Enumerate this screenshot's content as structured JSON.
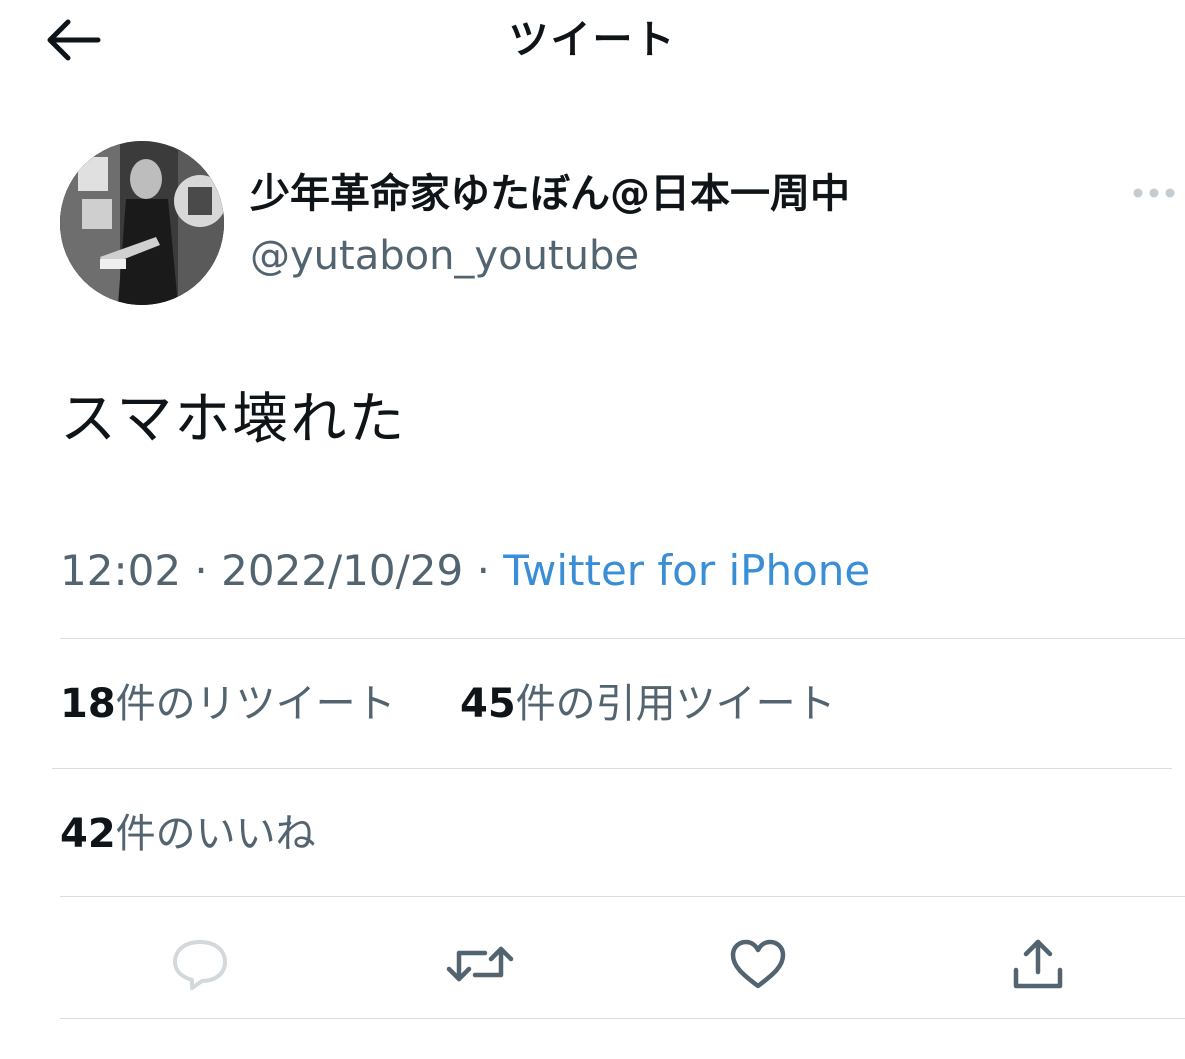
{
  "header": {
    "title": "ツイート",
    "back_icon": "arrow-left-icon"
  },
  "author": {
    "display_name": "少年革命家ゆたぼん@日本一周中",
    "handle": "@yutabon_youtube",
    "avatar_icon": "profile-photo"
  },
  "menu": {
    "more_icon": "more-horizontal-icon"
  },
  "tweet": {
    "text": "スマホ壊れた"
  },
  "meta": {
    "time": "12:02",
    "separator": "·",
    "date": "2022/10/29",
    "source": "Twitter for iPhone"
  },
  "stats": {
    "retweets": {
      "count": "18",
      "label": "件のリツイート"
    },
    "quotes": {
      "count": "45",
      "label": "件の引用ツイート"
    },
    "likes": {
      "count": "42",
      "label": "件のいいね"
    }
  },
  "actions": {
    "reply_icon": "reply-icon",
    "retweet_icon": "retweet-icon",
    "like_icon": "heart-icon",
    "share_icon": "share-icon"
  },
  "colors": {
    "text": "#0f1419",
    "secondary": "#536471",
    "link": "#3a8ed6",
    "divider": "#d9dde1",
    "icon": "#536471"
  }
}
